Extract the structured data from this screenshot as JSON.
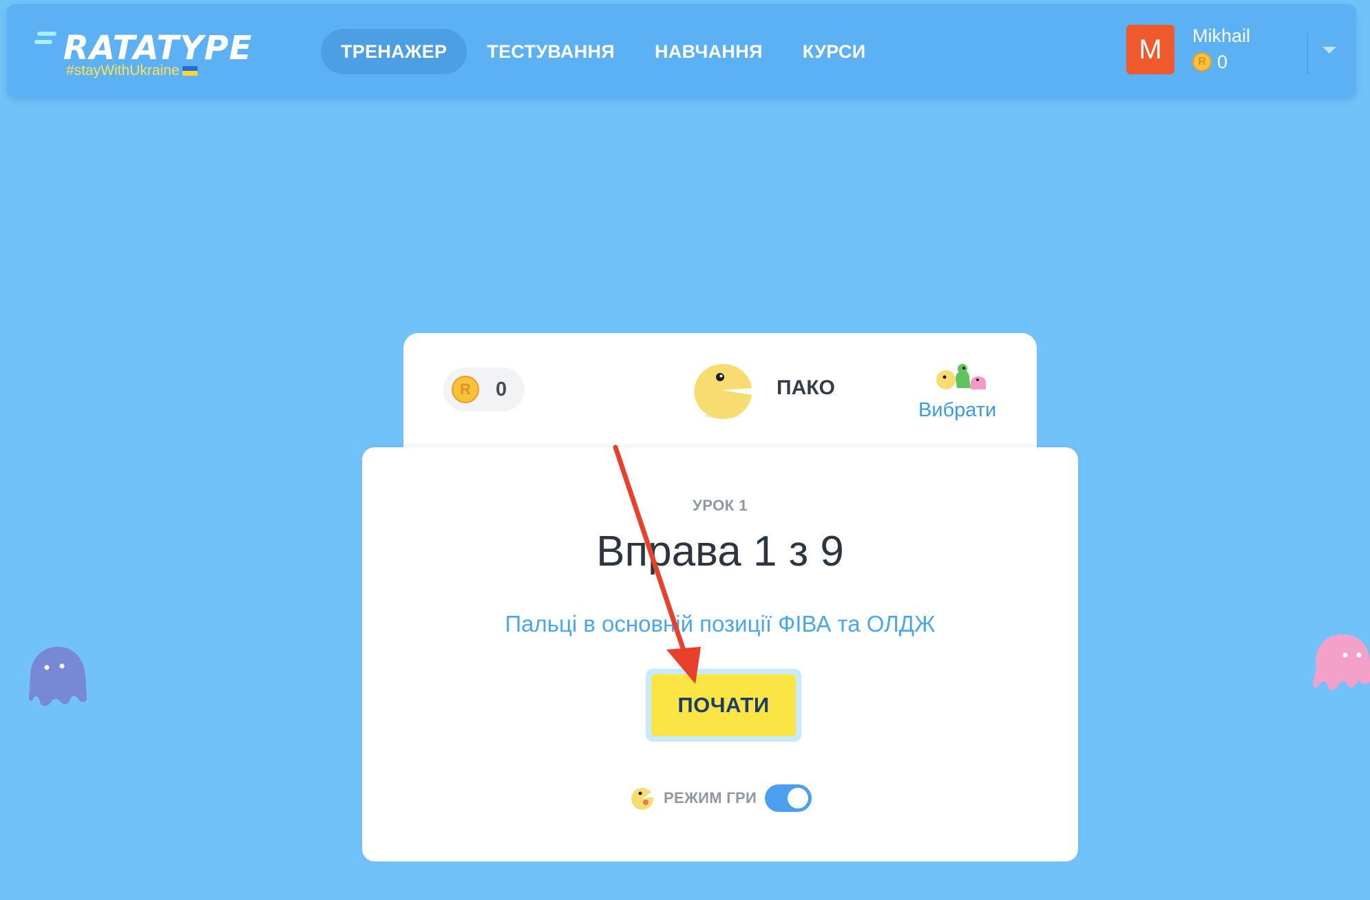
{
  "header": {
    "logo": {
      "wordmark": "RATATYPE",
      "tagline": "#stayWithUkraine"
    },
    "nav": [
      {
        "label": "ТРЕНАЖЕР",
        "active": true
      },
      {
        "label": "ТЕСТУВАННЯ",
        "active": false
      },
      {
        "label": "НАВЧАННЯ",
        "active": false
      },
      {
        "label": "КУРСИ",
        "active": false
      }
    ],
    "user": {
      "initial": "M",
      "name": "Mikhail",
      "coins": "0",
      "avatar_color": "#ee5a2c"
    }
  },
  "character_card": {
    "coins": "0",
    "character_name": "ПАКО",
    "choose_label": "Вибрати"
  },
  "exercise_card": {
    "lesson_label": "УРОК 1",
    "exercise_title": "Вправа 1 з 9",
    "description": "Пальці в основній позиції ФІВА та ОЛДЖ",
    "start_label": "ПОЧАТИ",
    "game_mode_label": "РЕЖИМ ГРИ",
    "game_mode_on": true
  },
  "colors": {
    "background": "#72c2fa",
    "header": "#5cb1f4",
    "accent_blue": "#49a7ee",
    "start_button": "#fbe544",
    "annotation_arrow": "#e8402a"
  }
}
